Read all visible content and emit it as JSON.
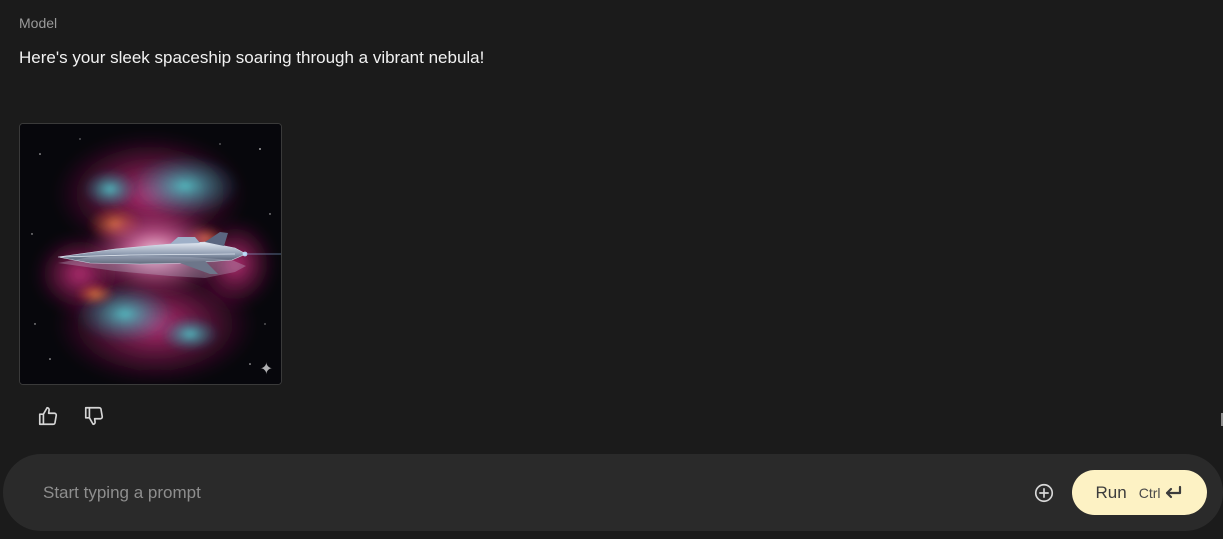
{
  "message": {
    "role_label": "Model",
    "text": "Here's your sleek spaceship soaring through a vibrant nebula!"
  },
  "image": {
    "badge_icon": "sparkle-icon",
    "colors": {
      "magenta": "#e03a8c",
      "cyan": "#2fb3b8",
      "orange": "#e8743b",
      "space": "#07070c"
    }
  },
  "feedback": {
    "thumbs_up_icon": "thumbs-up-icon",
    "thumbs_down_icon": "thumbs-down-icon"
  },
  "composer": {
    "placeholder": "Start typing a prompt",
    "add_icon": "add-circle-icon",
    "run_label": "Run",
    "shortcut_label": "Ctrl",
    "shortcut_icon": "enter-icon",
    "run_color": "#fdf2c4"
  }
}
